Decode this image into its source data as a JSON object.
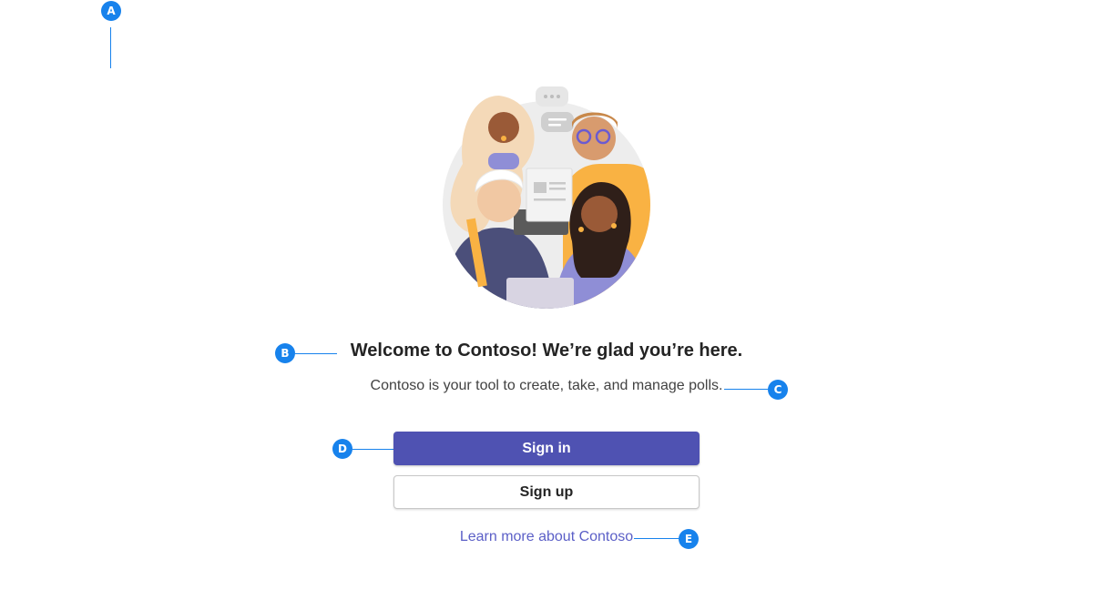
{
  "colors": {
    "callout": "#1782ec",
    "primary_button": "#4f52b2",
    "link": "#5b5fc7",
    "illustration_bg": "#ededed",
    "skin_light": "#f1c8a3",
    "skin_mid": "#d89b6e",
    "skin_dark": "#9a5a37",
    "hair_blonde": "#f4d9b8",
    "hair_dark": "#2f1f19",
    "shirt_purple": "#8f8ed6",
    "shirt_navy": "#4b4f7a",
    "shirt_orange": "#f9b243"
  },
  "callouts": {
    "a": "A",
    "b": "B",
    "c": "C",
    "d": "D",
    "e": "E"
  },
  "welcome": {
    "title": "Welcome to Contoso! We’re glad you’re here.",
    "subtitle": "Contoso is your tool to create, take, and manage polls."
  },
  "actions": {
    "sign_in": "Sign in",
    "sign_up": "Sign up",
    "learn_more": "Learn more about Contoso"
  }
}
